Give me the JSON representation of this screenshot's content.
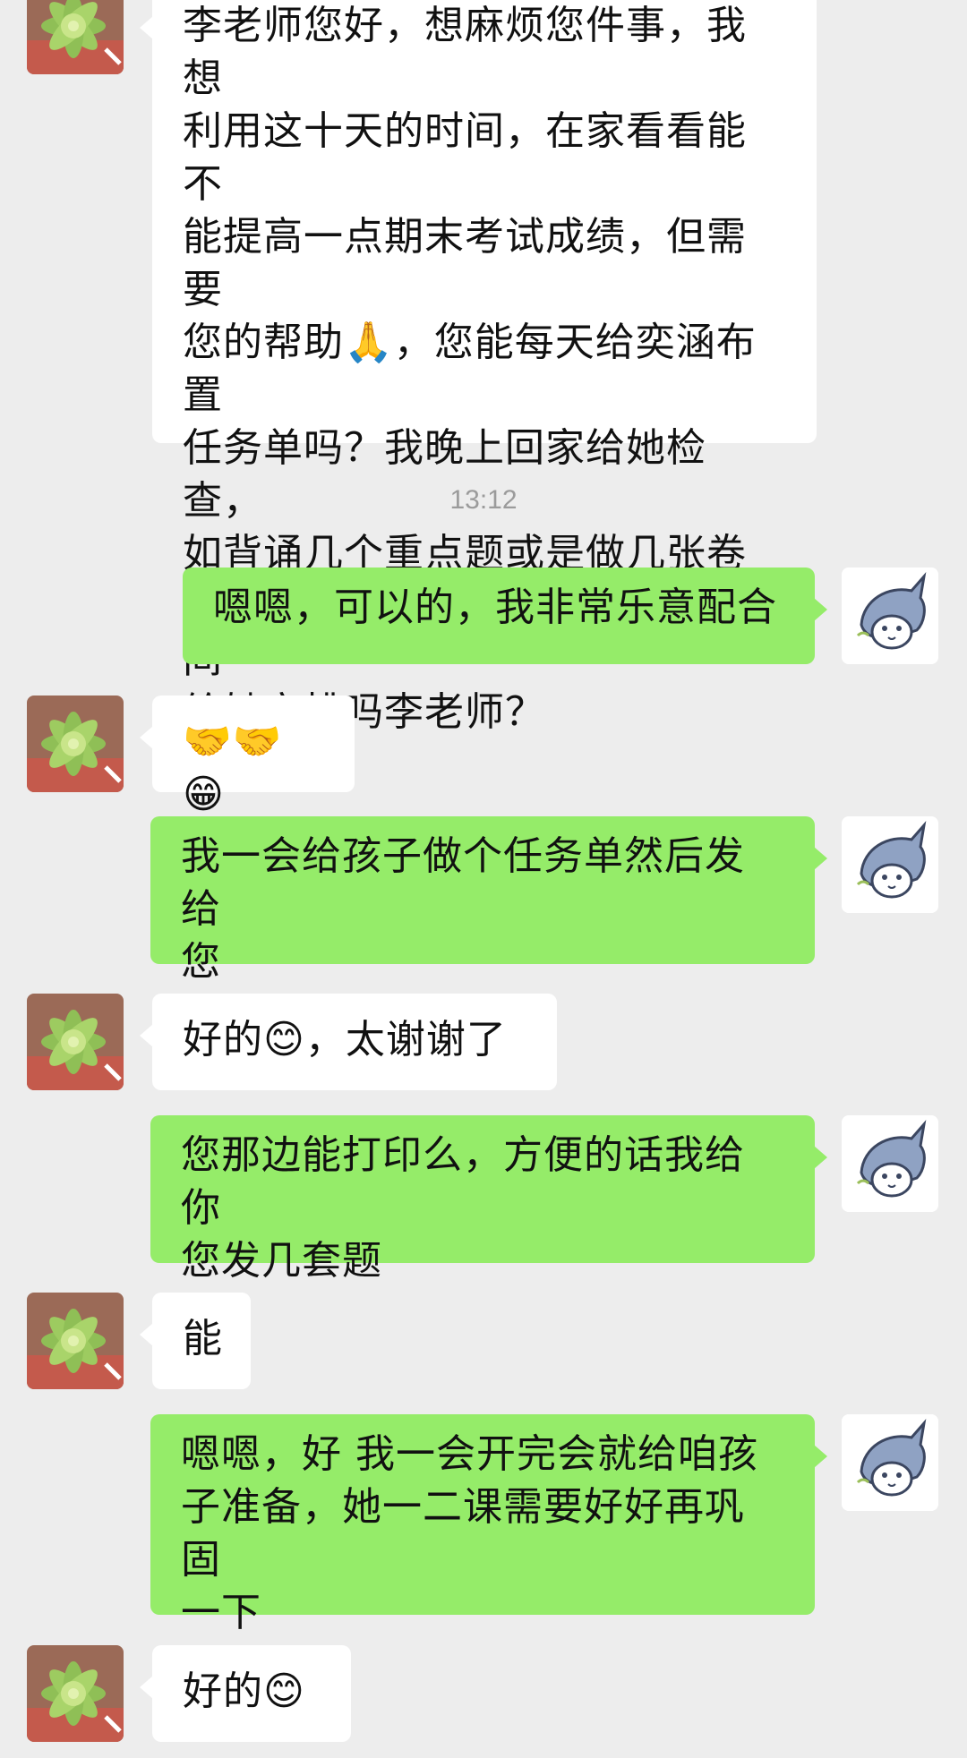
{
  "messages": [
    {
      "side": "left",
      "text": "李老师您好，想麻烦您件事，我想\n利用这十天的时间，在家看看能不\n能提高一点期末考试成绩，但需要\n您的帮助🙏，您能每天给奕涵布置\n任务单吗？我晚上回家给她检查，\n如背诵几个重点题或是做几张卷\n子，然后拍照片发给您。您有时间\n给她安排吗李老师？"
    },
    {
      "side": "right",
      "text": "嗯嗯，可以的，我非常乐意配合"
    },
    {
      "side": "left",
      "text": "🤝🤝😁"
    },
    {
      "side": "right",
      "text": "我一会给孩子做个任务单然后发给\n您"
    },
    {
      "side": "left",
      "text": "好的😊，太谢谢了"
    },
    {
      "side": "right",
      "text": "您那边能打印么，方便的话我给你\n您发几套题"
    },
    {
      "side": "left",
      "text": "能"
    },
    {
      "side": "right",
      "text": "嗯嗯，好 我一会开完会就给咱孩\n子准备，她一二课需要好好再巩固\n一下"
    },
    {
      "side": "left",
      "text": "好的😊"
    }
  ],
  "timestamp": "13:12",
  "colors": {
    "background": "#ededed",
    "left_bubble": "#ffffff",
    "right_bubble": "#95ec69"
  },
  "icons": {
    "left_avatar": "succulent-plant-avatar",
    "right_avatar": "shark-avatar"
  }
}
